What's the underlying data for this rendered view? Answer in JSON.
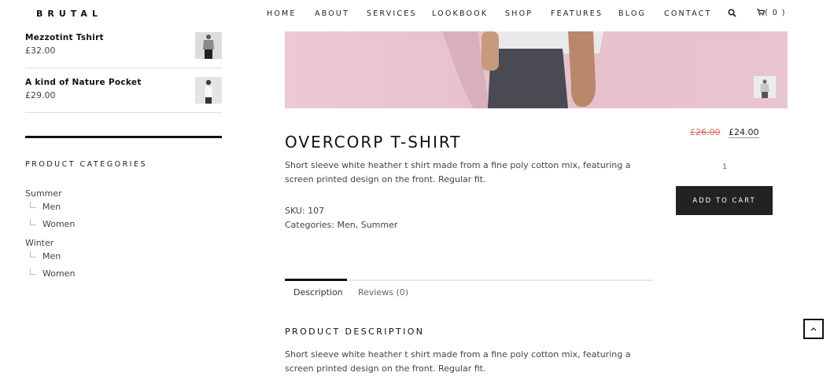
{
  "header": {
    "logo": "BRUTAL",
    "nav": [
      "HOME",
      "ABOUT",
      "SERVICES",
      "LOOKBOOK",
      "SHOP",
      "FEATURES",
      "BLOG",
      "CONTACT"
    ],
    "cart_count": "( 0 )"
  },
  "sidebar": {
    "products": [
      {
        "name": "Mezzotint Tshirt",
        "price": "£32.00"
      },
      {
        "name": "A kind of Nature Pocket",
        "price": "£29.00"
      }
    ],
    "categories_title": "PRODUCT CATEGORIES",
    "categories": [
      {
        "name": "Summer",
        "children": [
          "Men",
          "Women"
        ]
      },
      {
        "name": "Winter",
        "children": [
          "Men",
          "Women"
        ]
      }
    ]
  },
  "product": {
    "title": "OVERCORP T-SHIRT",
    "short_description": "Short sleeve white heather t shirt made from a fine poly cotton mix, featuring a screen printed design on the front. Regular fit.",
    "sku_label": "SKU: 107",
    "categories_label": "Categories: Men, Summer",
    "old_price": "£26.00",
    "new_price": "£24.00",
    "quantity": "1",
    "add_to_cart": "ADD TO CART"
  },
  "tabs": {
    "items": [
      "Description",
      "Reviews (0)"
    ],
    "active": "Description"
  },
  "description_section": {
    "title": "PRODUCT DESCRIPTION",
    "text": "Short sleeve white heather t shirt made from a fine poly cotton mix, featuring a screen printed design on the front. Regular fit."
  },
  "colors": {
    "hero_bg": "#e8c3cf",
    "sale_price": "#d86a5a",
    "button_bg": "#222222"
  }
}
